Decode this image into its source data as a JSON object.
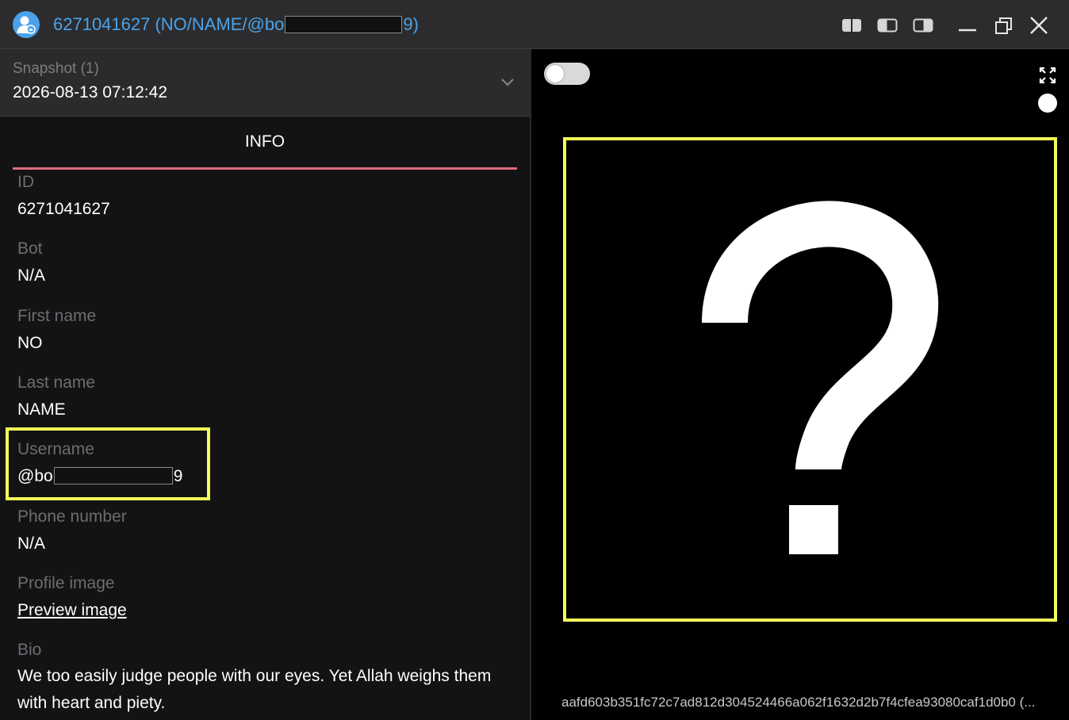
{
  "window": {
    "title_prefix": "6271041627 (NO/NAME/@bo",
    "title_suffix": "9)",
    "accent_color": "#4aa3ea",
    "icons": [
      "user-icon",
      "layout-left-icon",
      "layout-center-icon",
      "layout-right-icon",
      "minimize-icon",
      "restore-icon",
      "close-icon"
    ]
  },
  "snapshot": {
    "label": "Snapshot (1)",
    "value": "2026-08-13 07:12:42"
  },
  "tab": {
    "label": "INFO",
    "underline_color": "#e26b7e"
  },
  "fields": {
    "id": {
      "label": "ID",
      "value": "6271041627"
    },
    "bot": {
      "label": "Bot",
      "value": "N/A"
    },
    "first_name": {
      "label": "First name",
      "value": "NO"
    },
    "last_name": {
      "label": "Last name",
      "value": "NAME"
    },
    "username": {
      "label": "Username",
      "prefix": "@bo",
      "suffix": "9"
    },
    "phone": {
      "label": "Phone number",
      "value": "N/A"
    },
    "profile_image": {
      "label": "Profile image",
      "link": "Preview image"
    },
    "bio": {
      "label": "Bio",
      "value": "We too easily judge people with our eyes. Yet Allah weighs them with heart and piety."
    }
  },
  "preview": {
    "hash": "aafd603b351fc72c7ad812d304524466a062f1632d2b7f4cfea93080caf1d0b0 (...",
    "highlight_color": "#f3ff57"
  }
}
